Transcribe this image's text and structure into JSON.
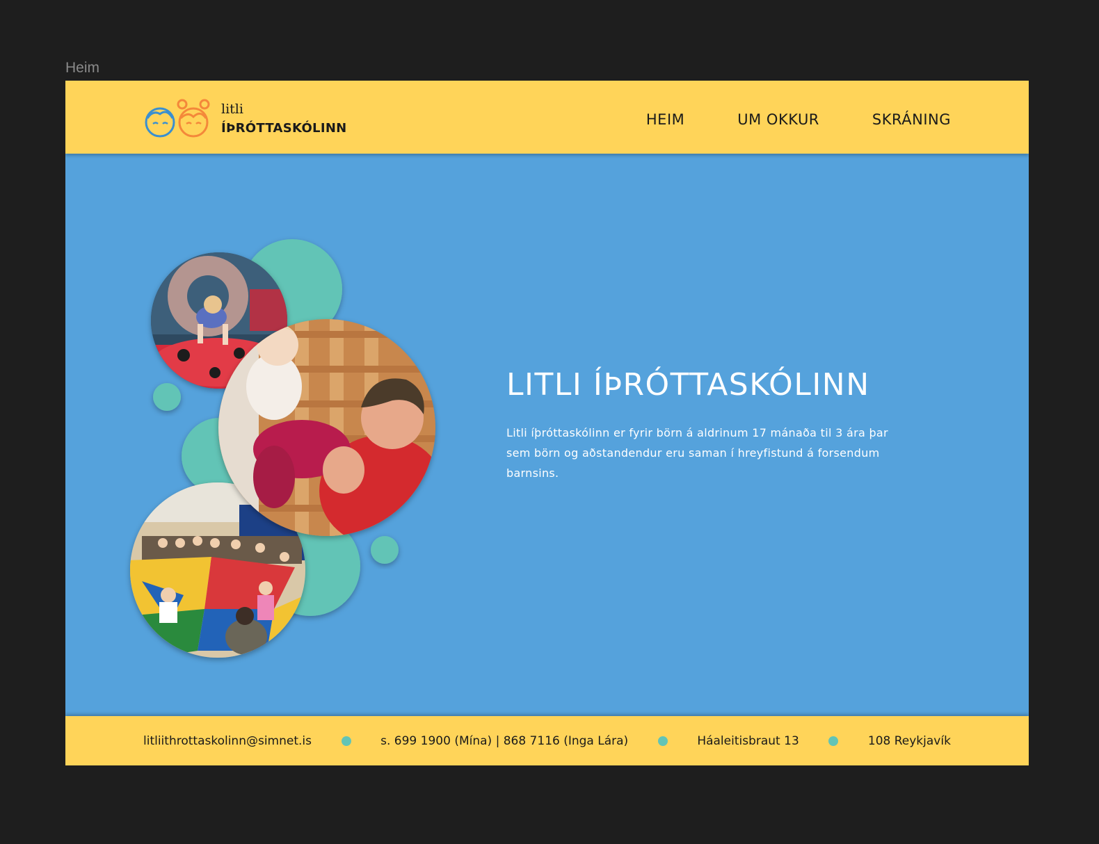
{
  "frame": {
    "label": "Heim"
  },
  "header": {
    "logo": {
      "small": "litli",
      "big": "ÍÞRÓTTASKÓLINN"
    },
    "nav": [
      {
        "label": "HEIM"
      },
      {
        "label": "UM OKKUR"
      },
      {
        "label": "SKRÁNING"
      }
    ]
  },
  "hero": {
    "title": "LITLI ÍÞRÓTTASKÓLINN",
    "text": "Litli íþróttaskólinn er fyrir börn á aldrinum 17 mánaða til 3 ára þar sem börn og aðstandendur eru saman í hreyfistund á forsendum barnsins."
  },
  "footer": {
    "email": "litliithrottaskolinn@simnet.is",
    "phone": "s. 699 1900 (Mína) | 868 7116 (Inga Lára)",
    "street": "Háaleitisbraut 13",
    "city": "108 Reykjavík"
  },
  "colors": {
    "yellow": "#ffd459",
    "blue": "#55a2dc",
    "teal": "#62c4b6",
    "logo_blue": "#3a8fd0",
    "logo_orange": "#f4883a"
  }
}
